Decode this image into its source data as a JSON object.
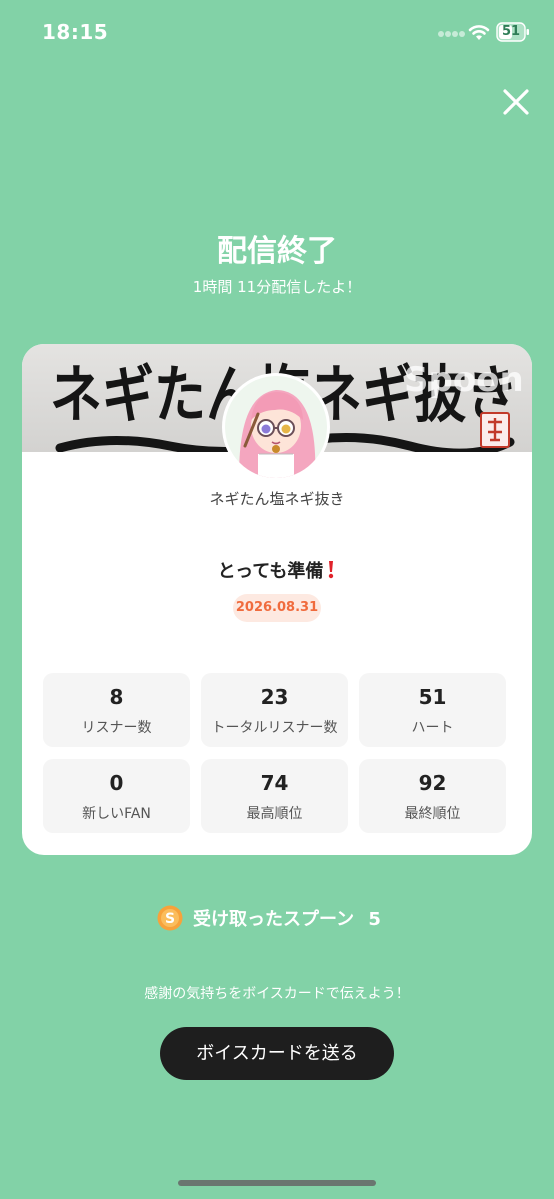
{
  "status_bar": {
    "time": "18:15",
    "battery": "51"
  },
  "header": {
    "title": "配信終了",
    "subtitle": "1時間 11分配信したよ！"
  },
  "card": {
    "banner_text": "ネギたん塩ネギ抜き",
    "watermark": "Spoon",
    "channel_name": "ネギたん塩ネギ抜き",
    "stream_title": "とっても準備",
    "date": "2026.08.31",
    "stats": [
      {
        "value": "8",
        "label": "リスナー数"
      },
      {
        "value": "23",
        "label": "トータルリスナー数"
      },
      {
        "value": "51",
        "label": "ハート"
      },
      {
        "value": "0",
        "label": "新しいFAN"
      },
      {
        "value": "74",
        "label": "最高順位"
      },
      {
        "value": "92",
        "label": "最終順位"
      }
    ]
  },
  "spoons": {
    "label": "受け取ったスプーン",
    "count": "5"
  },
  "thanks_text": "感謝の気持ちをボイスカードで伝えよう！",
  "send_button": "ボイスカードを送る",
  "icons": {
    "close": "close-icon",
    "coin": "spoon-coin-icon",
    "wifi": "wifi-icon"
  },
  "colors": {
    "background": "#82d2a7",
    "date_badge": "#f06b3d",
    "button": "#1e1e1e"
  }
}
